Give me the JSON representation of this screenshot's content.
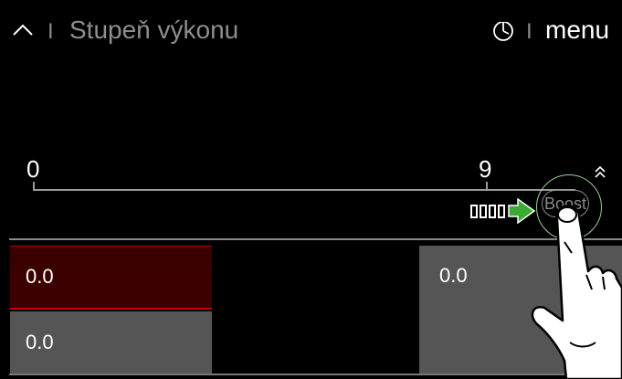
{
  "header": {
    "back_icon": "chevron-up-icon",
    "separator": "I",
    "title": "Stupeň výkonu",
    "timer_icon": "timer-icon",
    "menu_label": "menu"
  },
  "slider": {
    "min_label": "0",
    "max_label": "9",
    "boost_label": "Boost",
    "boost_arrow_color": "#3aaa35",
    "chevron_icon": "double-chevron-up-icon"
  },
  "zones": {
    "left_top_value": "0.0",
    "left_bottom_value": "0.0",
    "right_value": "0.0"
  },
  "colors": {
    "active_zone_border": "#c00000",
    "active_zone_bg": "#3a0000",
    "inactive_zone_bg": "#555555",
    "touch_ring": "#9fcd99"
  }
}
